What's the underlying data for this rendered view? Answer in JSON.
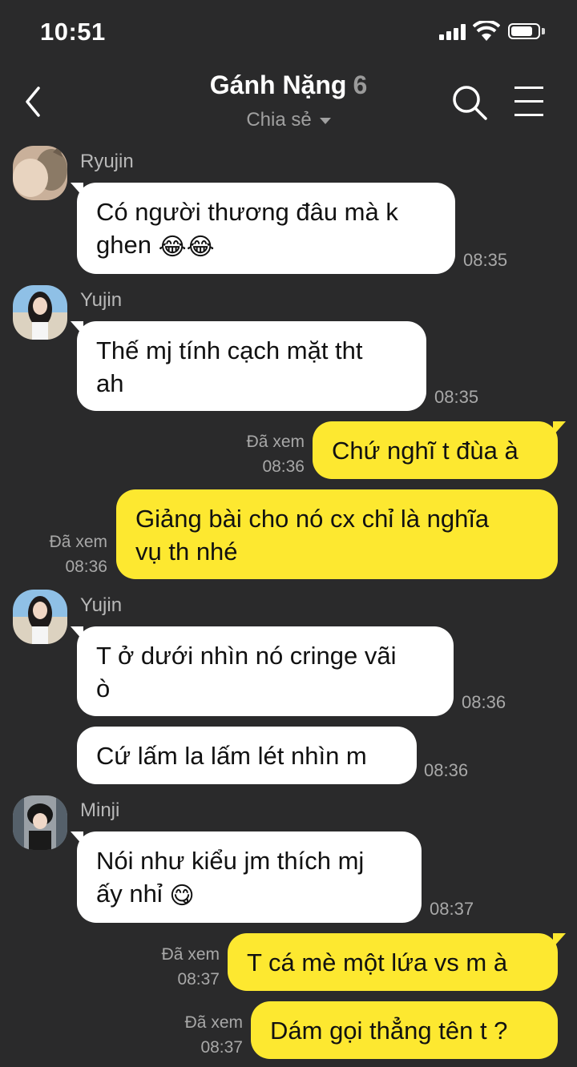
{
  "status": {
    "time": "10:51"
  },
  "header": {
    "title": "Gánh Nặng",
    "member_count": "6",
    "subtitle": "Chia sẻ"
  },
  "icons": {
    "back": "chevron-left-icon",
    "search": "search-icon",
    "menu": "hamburger-menu-icon"
  },
  "colors": {
    "background": "#2a2a2b",
    "outgoing_bubble": "#fde830",
    "incoming_bubble": "#ffffff"
  },
  "messages": [
    {
      "sender": "Ryujin",
      "line1": "Có người thương đâu mà k",
      "line2": "ghen",
      "emoji": "😂😂",
      "time": "08:35"
    },
    {
      "sender": "Yujin",
      "line1": "Thế mj tính cạch mặt tht",
      "line2": "ah",
      "time": "08:35"
    },
    {
      "text": "Chứ nghĩ t đùa à",
      "read": "Đã xem",
      "time": "08:36"
    },
    {
      "line1": "Giảng bài cho nó cx chỉ là nghĩa",
      "line2": "vụ th nhé",
      "read": "Đã xem",
      "time": "08:36"
    },
    {
      "sender": "Yujin",
      "line1": "T ở dưới nhìn nó cringe vãi",
      "line2": "ò",
      "time": "08:36"
    },
    {
      "text": "Cứ lấm la lấm lét nhìn m",
      "time": "08:36"
    },
    {
      "sender": "Minji",
      "line1": "Nói như kiểu jm thích mj",
      "line2": "ấy nhỉ",
      "emoji": "😋",
      "time": "08:37"
    },
    {
      "text": "T cá mè một lứa vs m à",
      "read": "Đã xem",
      "time": "08:37"
    },
    {
      "text": "Dám gọi thẳng tên t ?",
      "read": "Đã xem",
      "time": "08:37"
    }
  ]
}
